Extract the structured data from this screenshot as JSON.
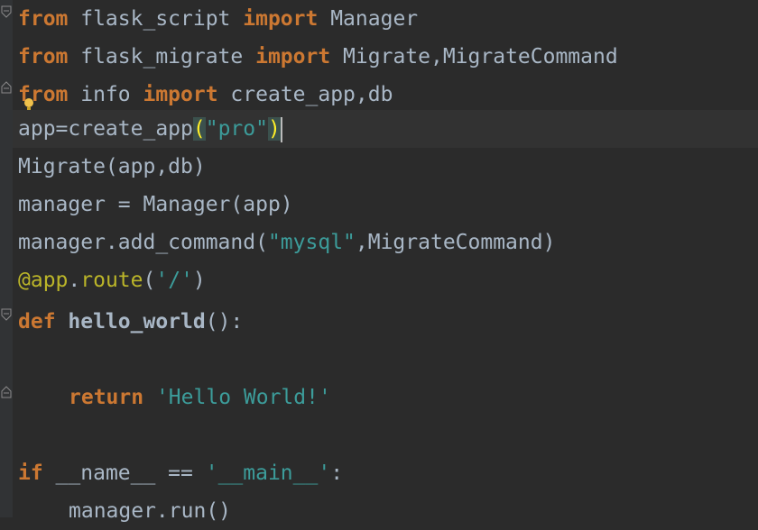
{
  "code": {
    "l1": {
      "kw1": "from",
      "mod": " flask_script ",
      "kw2": "import",
      "rest": " Manager"
    },
    "l2": {
      "kw1": "from",
      "mod": " flask_migrate ",
      "kw2": "import",
      "rest": " Migrate,MigrateCommand"
    },
    "l3": {
      "kw1": "from",
      "mod": " info ",
      "kw2": "import",
      "rest": " create_app,db"
    },
    "l4": {
      "pre": "app=create_app",
      "open": "(",
      "str": "\"pro\"",
      "close": ")"
    },
    "l5": {
      "text": "Migrate(app,db)"
    },
    "l6": {
      "text": "manager = Manager(app)"
    },
    "l7": {
      "pre": "manager.add_command(",
      "str": "\"mysql\"",
      "post": ",MigrateCommand)"
    },
    "l8": {
      "at": "@",
      "app": "app",
      "dot": ".",
      "route": "route",
      "open": "(",
      "str": "'/'",
      "close": ")"
    },
    "l9": {
      "kw": "def",
      "name": " hello_world",
      "rest": "():"
    },
    "l11": {
      "kw": "return",
      "str": "'Hello World!'"
    },
    "l13": {
      "kw": "if",
      "pre": " __name__ == ",
      "str": "'__main__'",
      "post": ":"
    },
    "l14": {
      "text": "manager.run()"
    }
  },
  "icons": [
    "fold-icon",
    "intention-bulb-icon"
  ]
}
